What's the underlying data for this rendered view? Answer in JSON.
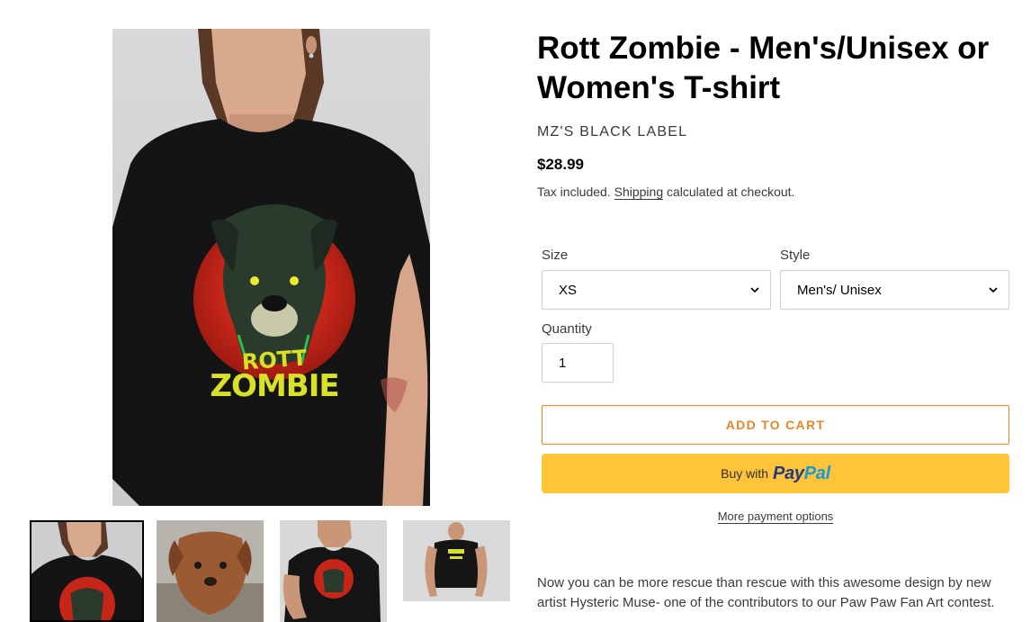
{
  "product": {
    "title": "Rott Zombie - Men's/Unisex or Women's T-shirt",
    "vendor": "MZ'S BLACK LABEL",
    "price": "$28.99",
    "tax_text_before": "Tax included. ",
    "shipping_link": "Shipping",
    "tax_text_after": " calculated at checkout.",
    "description": "Now you can be more rescue than rescue with this awesome design by new artist Hysteric Muse- one of the contributors to our Paw Paw Fan Art contest."
  },
  "options": {
    "size": {
      "label": "Size",
      "value": "XS"
    },
    "style": {
      "label": "Style",
      "value": "Men's/ Unisex"
    },
    "quantity": {
      "label": "Quantity",
      "value": "1"
    }
  },
  "buttons": {
    "add_to_cart": "ADD TO CART",
    "paypal_prefix": "Buy with",
    "paypal_brand_1": "Pay",
    "paypal_brand_2": "Pal",
    "more_payment": "More payment options"
  },
  "artwork": {
    "logo_line_1": "ROTT",
    "logo_line_2": "ZOMBIE"
  },
  "icons": {
    "select_chevron": "chevron-down-icon"
  },
  "colors": {
    "accent": "#e4862a",
    "paypal_yellow": "#ffc439",
    "paypal_dark": "#253b80",
    "paypal_light": "#179bd7",
    "logo_yellow": "#d8e02a",
    "moon_red": "#c52618"
  }
}
